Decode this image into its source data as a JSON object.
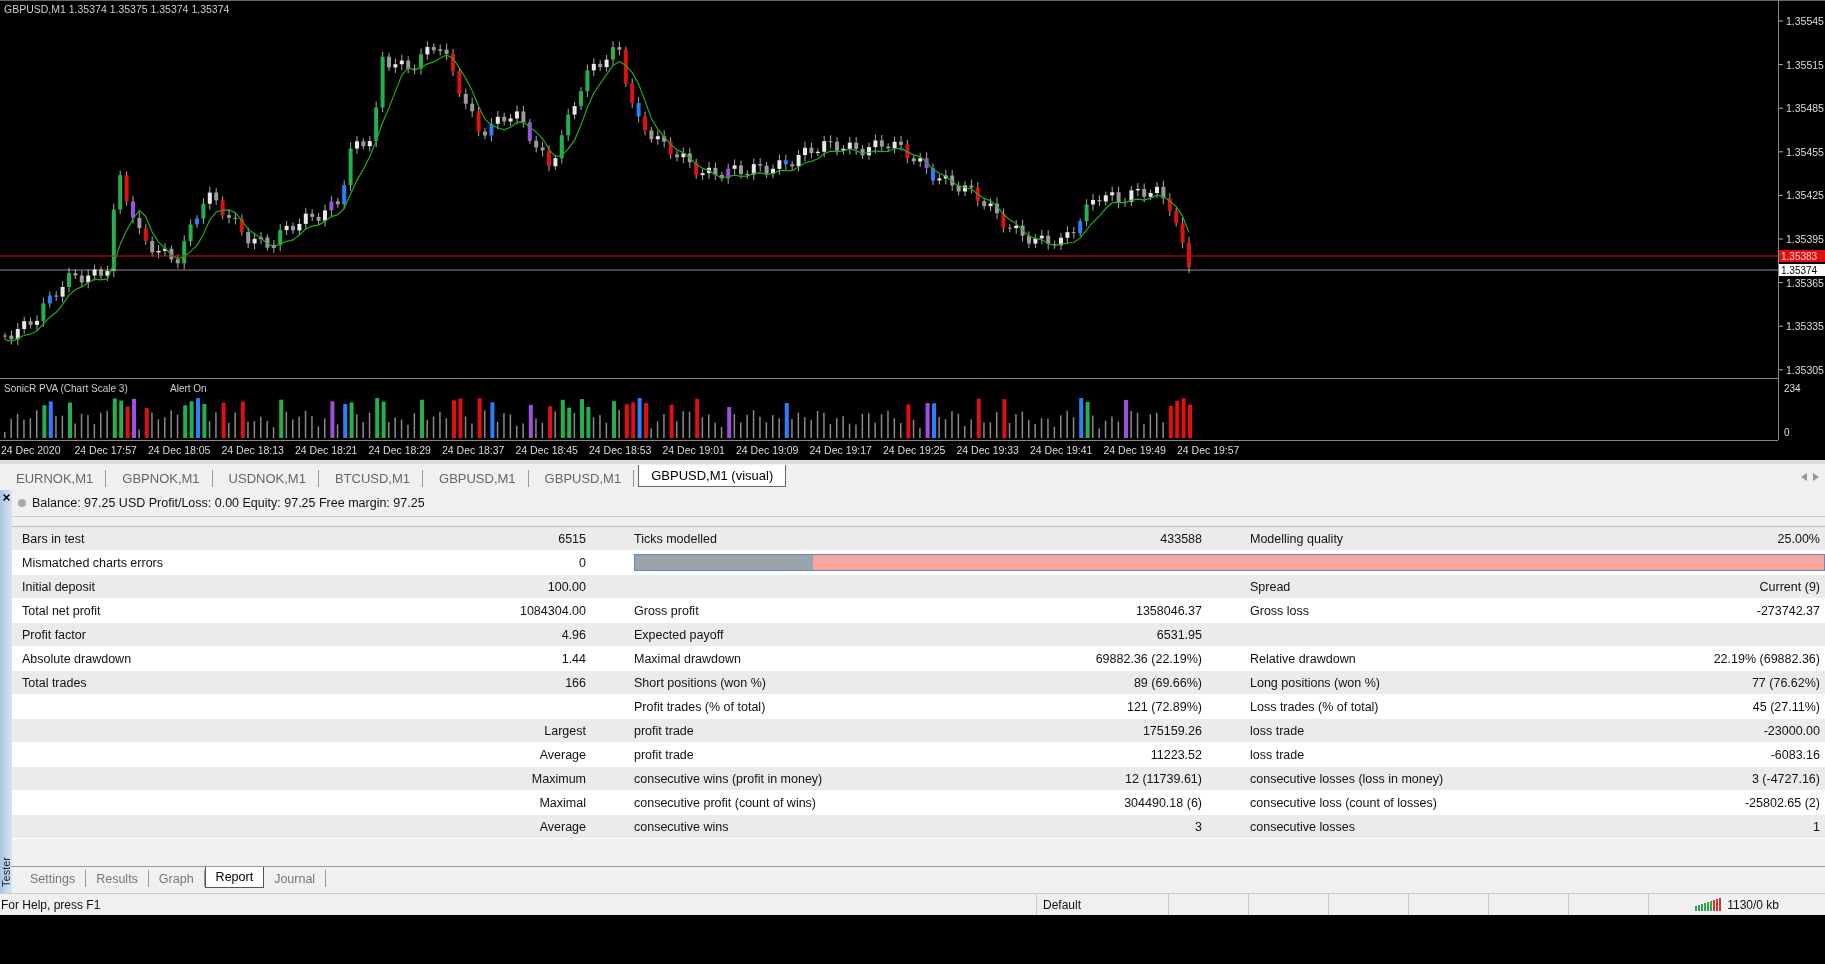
{
  "chart": {
    "header": "GBPUSD,M1 1.35374 1.35375 1.35374 1.35374",
    "price_axis": [
      "1.35545",
      "1.35515",
      "1.35485",
      "1.35455",
      "1.35425",
      "1.35395",
      "1.35365",
      "1.35335",
      "1.35305"
    ],
    "price_markers": [
      {
        "label": "1.35383",
        "color": "#e01010"
      },
      {
        "label": "1.35374",
        "color": "#ffffff"
      }
    ],
    "indicator": {
      "name": "SonicR PVA (Chart Scale 3)",
      "alert": "Alert On",
      "scale": [
        "234",
        "0"
      ]
    },
    "time_axis": [
      "24 Dec 2020",
      "24 Dec 17:57",
      "24 Dec 18:05",
      "24 Dec 18:13",
      "24 Dec 18:21",
      "24 Dec 18:29",
      "24 Dec 18:37",
      "24 Dec 18:45",
      "24 Dec 18:53",
      "24 Dec 19:01",
      "24 Dec 19:09",
      "24 Dec 19:17",
      "24 Dec 19:25",
      "24 Dec 19:33",
      "24 Dec 19:41",
      "24 Dec 19:49",
      "24 Dec 19:57"
    ]
  },
  "chart_tabs": [
    {
      "label": "EURNOK,M1",
      "selected": false
    },
    {
      "label": "GBPNOK,M1",
      "selected": false
    },
    {
      "label": "USDNOK,M1",
      "selected": false
    },
    {
      "label": "BTCUSD,M1",
      "selected": false
    },
    {
      "label": "GBPUSD,M1",
      "selected": false
    },
    {
      "label": "GBPUSD,M1",
      "selected": false
    },
    {
      "label": "GBPUSD,M1 (visual)",
      "selected": true
    }
  ],
  "account_line": "Balance: 97.25 USD  Profit/Loss: 0.00  Equity: 97.25  Free margin: 97.25",
  "report": {
    "rows": [
      {
        "kind": "values",
        "label_1": "Bars in test",
        "value_1": "6515",
        "label_2": "Ticks modelled",
        "value_2": "433588",
        "label_3": "Modelling quality",
        "value_3": "25.00%"
      },
      {
        "kind": "quality",
        "label_1": "Mismatched charts errors",
        "value_1": "0",
        "level": 0.15
      },
      {
        "kind": "values",
        "label_1": "Initial deposit",
        "value_1": "100.00",
        "label_3": "Spread",
        "value_3": "Current (9)"
      },
      {
        "kind": "values",
        "label_1": "Total net profit",
        "value_1": "1084304.00",
        "label_2": "Gross profit",
        "value_2": "1358046.37",
        "label_3": "Gross loss",
        "value_3": "-273742.37"
      },
      {
        "kind": "values",
        "label_1": "Profit factor",
        "value_1": "4.96",
        "label_2": "Expected payoff",
        "value_2": "6531.95"
      },
      {
        "kind": "values",
        "label_1": "Absolute drawdown",
        "value_1": "1.44",
        "label_2": "Maximal drawdown",
        "value_2": "69882.36 (22.19%)",
        "label_3": "Relative drawdown",
        "value_3": "22.19% (69882.36)"
      },
      {
        "kind": "values",
        "label_1": "Total trades",
        "value_1": "166",
        "label_2": "Short positions (won %)",
        "value_2": "89 (69.66%)",
        "label_3": "Long positions (won %)",
        "value_3": "77 (76.62%)"
      },
      {
        "kind": "values",
        "label_2": "Profit trades (% of total)",
        "value_2": "121 (72.89%)",
        "label_3": "Loss trades (% of total)",
        "value_3": "45 (27.11%)"
      },
      {
        "kind": "values",
        "value_1": "Largest",
        "label_2": "profit trade",
        "value_2": "175159.26",
        "label_3": "loss trade",
        "value_3": "-23000.00"
      },
      {
        "kind": "values",
        "value_1": "Average",
        "label_2": "profit trade",
        "value_2": "11223.52",
        "label_3": "loss trade",
        "value_3": "-6083.16"
      },
      {
        "kind": "values",
        "value_1": "Maximum",
        "label_2": "consecutive wins (profit in money)",
        "value_2": "12 (11739.61)",
        "label_3": "consecutive losses (loss in money)",
        "value_3": "3 (-4727.16)"
      },
      {
        "kind": "values",
        "value_1": "Maximal",
        "label_2": "consecutive profit (count of wins)",
        "value_2": "304490.18 (6)",
        "label_3": "consecutive loss (count of losses)",
        "value_3": "-25802.65 (2)"
      },
      {
        "kind": "values",
        "value_1": "Average",
        "label_2": "consecutive wins",
        "value_2": "3",
        "label_3": "consecutive losses",
        "value_3": "1"
      }
    ]
  },
  "tester_label": "Tester",
  "tester_tabs": [
    {
      "label": "Settings",
      "selected": false
    },
    {
      "label": "Results",
      "selected": false
    },
    {
      "label": "Graph",
      "selected": false
    },
    {
      "label": "Report",
      "selected": true
    },
    {
      "label": "Journal",
      "selected": false
    }
  ],
  "status_bar": {
    "help": "For Help, press F1",
    "profile": "Default",
    "memory": "1130/0 kb"
  }
}
